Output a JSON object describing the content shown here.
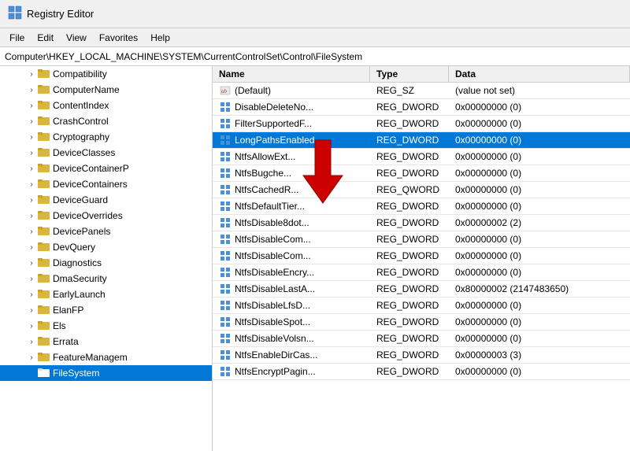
{
  "app": {
    "title": "Registry Editor",
    "icon": "registry"
  },
  "menu": {
    "items": [
      "File",
      "Edit",
      "View",
      "Favorites",
      "Help"
    ]
  },
  "address": {
    "path": "Computer\\HKEY_LOCAL_MACHINE\\SYSTEM\\CurrentControlSet\\Control\\FileSystem"
  },
  "header": {
    "name_col": "Name",
    "type_col": "Type",
    "data_col": "Data"
  },
  "tree": {
    "items": [
      {
        "label": "Compatibility",
        "indent": 2,
        "selected": false,
        "hasArrow": true
      },
      {
        "label": "ComputerName",
        "indent": 2,
        "selected": false,
        "hasArrow": true
      },
      {
        "label": "ContentIndex",
        "indent": 2,
        "selected": false,
        "hasArrow": true
      },
      {
        "label": "CrashControl",
        "indent": 2,
        "selected": false,
        "hasArrow": true
      },
      {
        "label": "Cryptography",
        "indent": 2,
        "selected": false,
        "hasArrow": true
      },
      {
        "label": "DeviceClasses",
        "indent": 2,
        "selected": false,
        "hasArrow": true
      },
      {
        "label": "DeviceContainerP",
        "indent": 2,
        "selected": false,
        "hasArrow": true
      },
      {
        "label": "DeviceContainers",
        "indent": 2,
        "selected": false,
        "hasArrow": true
      },
      {
        "label": "DeviceGuard",
        "indent": 2,
        "selected": false,
        "hasArrow": true
      },
      {
        "label": "DeviceOverrides",
        "indent": 2,
        "selected": false,
        "hasArrow": true
      },
      {
        "label": "DevicePanels",
        "indent": 2,
        "selected": false,
        "hasArrow": true
      },
      {
        "label": "DevQuery",
        "indent": 2,
        "selected": false,
        "hasArrow": true
      },
      {
        "label": "Diagnostics",
        "indent": 2,
        "selected": false,
        "hasArrow": true
      },
      {
        "label": "DmaSecurity",
        "indent": 2,
        "selected": false,
        "hasArrow": true
      },
      {
        "label": "EarlyLaunch",
        "indent": 2,
        "selected": false,
        "hasArrow": true
      },
      {
        "label": "ElanFP",
        "indent": 2,
        "selected": false,
        "hasArrow": true
      },
      {
        "label": "Els",
        "indent": 2,
        "selected": false,
        "hasArrow": true
      },
      {
        "label": "Errata",
        "indent": 2,
        "selected": false,
        "hasArrow": true
      },
      {
        "label": "FeatureManagem",
        "indent": 2,
        "selected": false,
        "hasArrow": true
      },
      {
        "label": "FileSystem",
        "indent": 2,
        "selected": true,
        "hasArrow": false
      }
    ]
  },
  "values": {
    "rows": [
      {
        "name": "(Default)",
        "type": "REG_SZ",
        "data": "(value not set)",
        "selected": false,
        "icon": "ab"
      },
      {
        "name": "DisableDeleteNo...",
        "type": "REG_DWORD",
        "data": "0x00000000 (0)",
        "selected": false,
        "icon": "dword"
      },
      {
        "name": "FilterSupportedF...",
        "type": "REG_DWORD",
        "data": "0x00000000 (0)",
        "selected": false,
        "icon": "dword"
      },
      {
        "name": "LongPathsEnabled",
        "type": "REG_DWORD",
        "data": "0x00000000 (0)",
        "selected": true,
        "icon": "dword"
      },
      {
        "name": "NtfsAllowExt...",
        "type": "REG_DWORD",
        "data": "0x00000000 (0)",
        "selected": false,
        "icon": "dword"
      },
      {
        "name": "NtfsBugche...",
        "type": "REG_DWORD",
        "data": "0x00000000 (0)",
        "selected": false,
        "icon": "dword"
      },
      {
        "name": "NtfsCachedR...",
        "type": "REG_QWORD",
        "data": "0x00000000 (0)",
        "selected": false,
        "icon": "dword"
      },
      {
        "name": "NtfsDefaultTier...",
        "type": "REG_DWORD",
        "data": "0x00000000 (0)",
        "selected": false,
        "icon": "dword"
      },
      {
        "name": "NtfsDisable8dot...",
        "type": "REG_DWORD",
        "data": "0x00000002 (2)",
        "selected": false,
        "icon": "dword"
      },
      {
        "name": "NtfsDisableCom...",
        "type": "REG_DWORD",
        "data": "0x00000000 (0)",
        "selected": false,
        "icon": "dword"
      },
      {
        "name": "NtfsDisableCom...",
        "type": "REG_DWORD",
        "data": "0x00000000 (0)",
        "selected": false,
        "icon": "dword"
      },
      {
        "name": "NtfsDisableEncry...",
        "type": "REG_DWORD",
        "data": "0x00000000 (0)",
        "selected": false,
        "icon": "dword"
      },
      {
        "name": "NtfsDisableLastA...",
        "type": "REG_DWORD",
        "data": "0x80000002 (2147483650)",
        "selected": false,
        "icon": "dword"
      },
      {
        "name": "NtfsDisableLfsD...",
        "type": "REG_DWORD",
        "data": "0x00000000 (0)",
        "selected": false,
        "icon": "dword"
      },
      {
        "name": "NtfsDisableSpot...",
        "type": "REG_DWORD",
        "data": "0x00000000 (0)",
        "selected": false,
        "icon": "dword"
      },
      {
        "name": "NtfsDisableVolsn...",
        "type": "REG_DWORD",
        "data": "0x00000000 (0)",
        "selected": false,
        "icon": "dword"
      },
      {
        "name": "NtfsEnableDirCas...",
        "type": "REG_DWORD",
        "data": "0x00000003 (3)",
        "selected": false,
        "icon": "dword"
      },
      {
        "name": "NtfsEncryptPagin...",
        "type": "REG_DWORD",
        "data": "0x00000000 (0)",
        "selected": false,
        "icon": "dword"
      }
    ]
  },
  "colors": {
    "selected_bg": "#0078d7",
    "selected_text": "#ffffff",
    "folder_yellow": "#dcb53c",
    "arrow_red": "#cc0000"
  }
}
